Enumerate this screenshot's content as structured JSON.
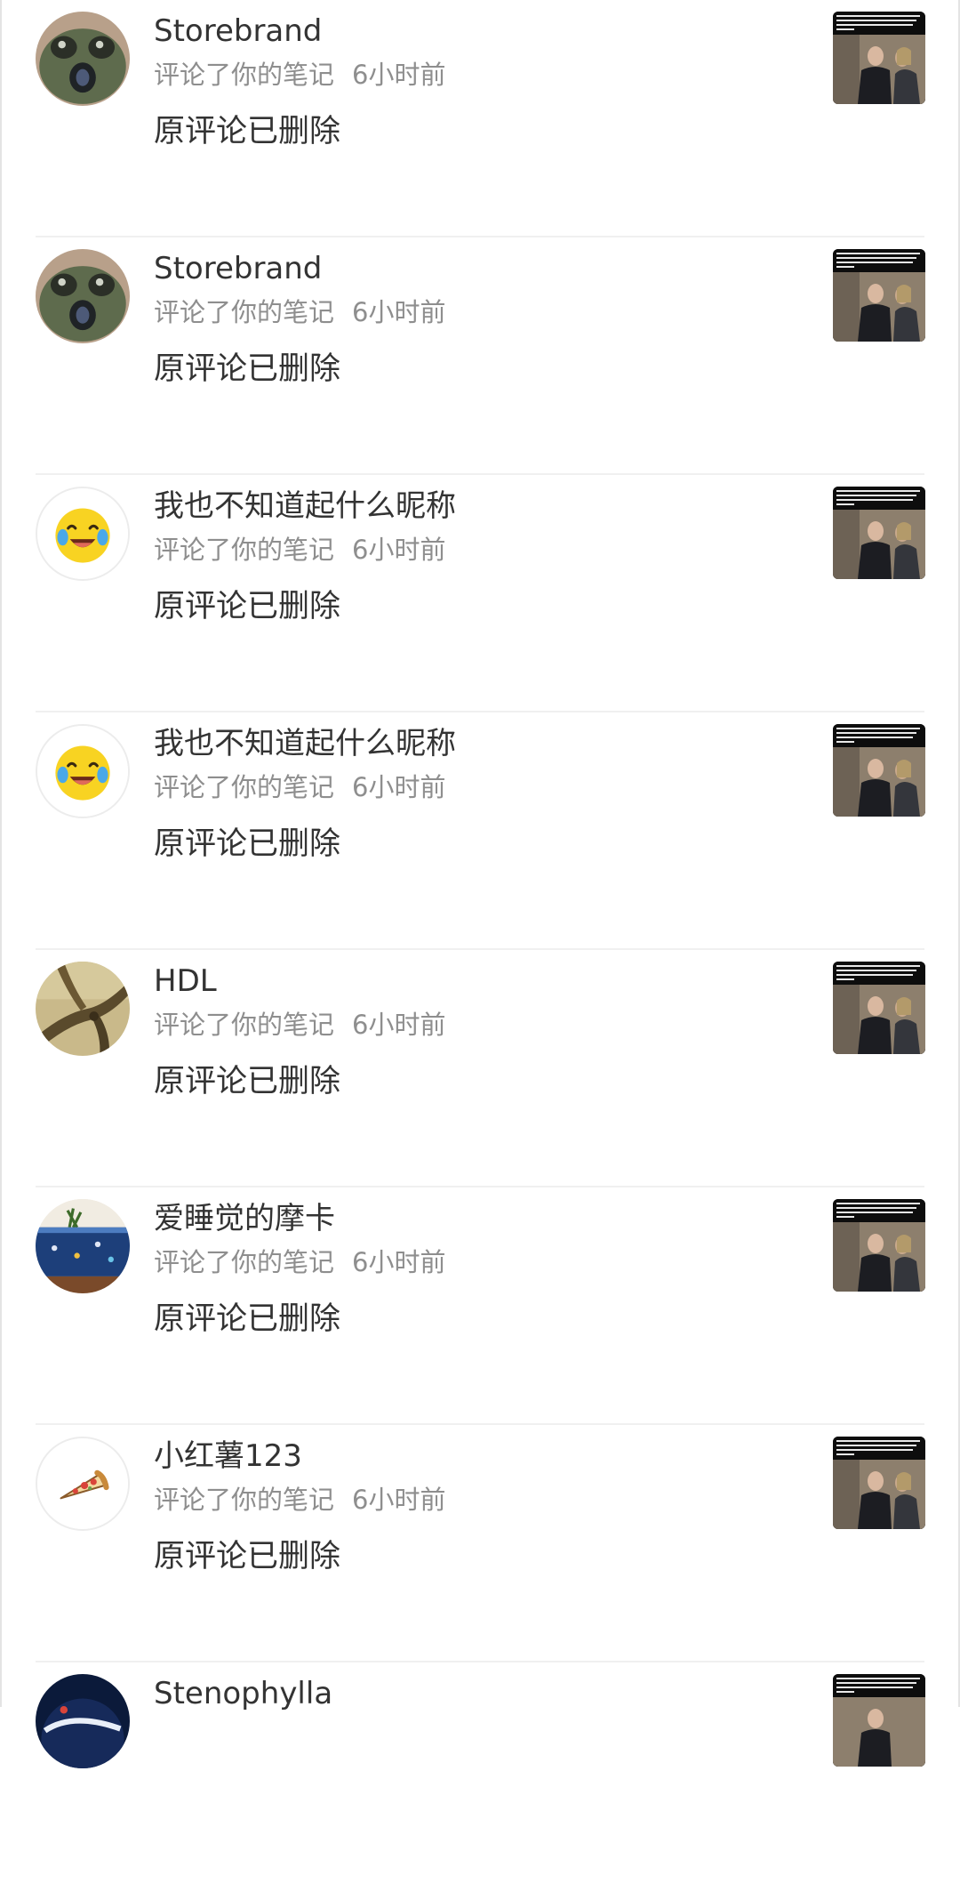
{
  "notifications": [
    {
      "username": "Storebrand",
      "action": "评论了你的笔记",
      "time": "6小时前",
      "comment": "原评论已删除",
      "avatar_icon": "alien-toy-avatar"
    },
    {
      "username": "Storebrand",
      "action": "评论了你的笔记",
      "time": "6小时前",
      "comment": "原评论已删除",
      "avatar_icon": "alien-toy-avatar"
    },
    {
      "username": "我也不知道起什么昵称",
      "action": "评论了你的笔记",
      "time": "6小时前",
      "comment": "原评论已删除",
      "avatar_icon": "laughing-emoji-avatar"
    },
    {
      "username": "我也不知道起什么昵称",
      "action": "评论了你的笔记",
      "time": "6小时前",
      "comment": "原评论已删除",
      "avatar_icon": "laughing-emoji-avatar"
    },
    {
      "username": "HDL",
      "action": "评论了你的笔记",
      "time": "6小时前",
      "comment": "原评论已删除",
      "avatar_icon": "tree-branch-avatar"
    },
    {
      "username": "爱睡觉的摩卡",
      "action": "评论了你的笔记",
      "time": "6小时前",
      "comment": "原评论已删除",
      "avatar_icon": "aquarium-avatar"
    },
    {
      "username": "小红薯123",
      "action": "评论了你的笔记",
      "time": "6小时前",
      "comment": "原评论已删除",
      "avatar_icon": "pizza-slice-avatar"
    },
    {
      "username": "Stenophylla",
      "action": "",
      "time": "",
      "comment": "",
      "avatar_icon": "dark-planet-avatar"
    }
  ],
  "thumbnail_caption": "Former DEA agent sentenced to 6 years in prison for using badge to protect drug trafficking friends"
}
